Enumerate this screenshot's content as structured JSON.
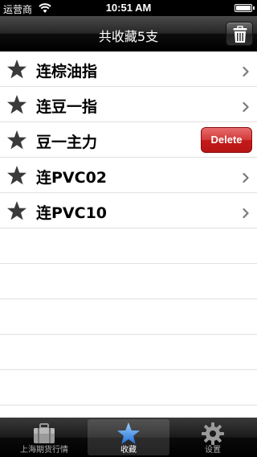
{
  "status_bar": {
    "carrier": "运营商",
    "time": "10:51 AM"
  },
  "navbar": {
    "title": "共收藏5支"
  },
  "favorites": [
    {
      "name": "连棕油指",
      "show_delete": false
    },
    {
      "name": "连豆一指",
      "show_delete": false
    },
    {
      "name": "豆一主力",
      "show_delete": true
    },
    {
      "name": "连PVC02",
      "show_delete": false
    },
    {
      "name": "连PVC10",
      "show_delete": false
    }
  ],
  "delete_label": "Delete",
  "tabbar": {
    "items": [
      {
        "label": "上海期货行情",
        "icon": "briefcase-icon",
        "active": false
      },
      {
        "label": "收藏",
        "icon": "star-icon",
        "active": true
      },
      {
        "label": "设置",
        "icon": "gear-icon",
        "active": false
      }
    ]
  },
  "colors": {
    "delete": "#c41a1a",
    "accent": "#2f8cf0"
  }
}
